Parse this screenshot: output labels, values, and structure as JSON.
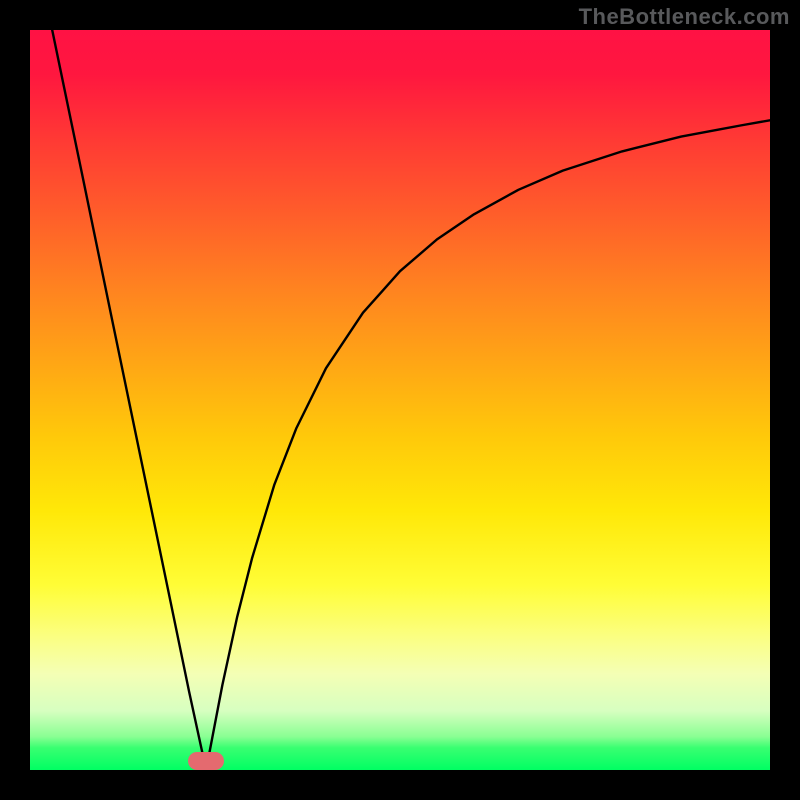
{
  "watermark": "TheBottleneck.com",
  "chart_data": {
    "type": "line",
    "title": "",
    "xlabel": "",
    "ylabel": "",
    "xlim": [
      0,
      100
    ],
    "ylim": [
      0,
      100
    ],
    "grid": false,
    "legend": false,
    "series": [
      {
        "name": "left-branch",
        "x": [
          3,
          7,
          11,
          15,
          19,
          21.5,
          23.8
        ],
        "y": [
          100,
          80.7,
          61.3,
          42,
          22.7,
          10.6,
          0
        ]
      },
      {
        "name": "right-branch",
        "x": [
          23.8,
          26,
          28,
          30,
          33,
          36,
          40,
          45,
          50,
          55,
          60,
          66,
          72,
          80,
          88,
          96,
          100
        ],
        "y": [
          0,
          11.5,
          20.7,
          28.6,
          38.5,
          46.2,
          54.3,
          61.8,
          67.4,
          71.7,
          75.1,
          78.4,
          81,
          83.6,
          85.6,
          87.1,
          87.8
        ]
      }
    ],
    "marker": {
      "x_pct": 23.8,
      "y_pct": 1.2
    }
  }
}
